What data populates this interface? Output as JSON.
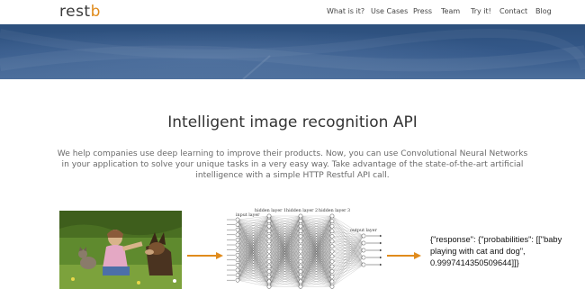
{
  "header": {
    "logo_main": "rest",
    "logo_accent": "b",
    "nav": [
      "What is it?",
      "Use Cases",
      "Press",
      "Team",
      "Try it!",
      "Contact",
      "Blog"
    ]
  },
  "hero": {
    "title": "Intelligent image recognition API",
    "description": "We help companies use deep learning to improve their products. Now, you can use Convolutional Neural Networks in your application to solve your unique tasks in a very easy way. Take advantage of the state-of-the-art artificial intelligence with a simple HTTP Restful API call."
  },
  "diagram": {
    "layer_labels": [
      "input layer",
      "hidden layer 1",
      "hidden layer 2",
      "hidden layer 3",
      "output layer"
    ],
    "response_text": "{\"response\": {\"probabilities\": [[\"baby playing with cat and dog\", 0.9997414350509644]]}"
  },
  "colors": {
    "accent": "#e08b1c",
    "banner": "#2c4f7c"
  }
}
